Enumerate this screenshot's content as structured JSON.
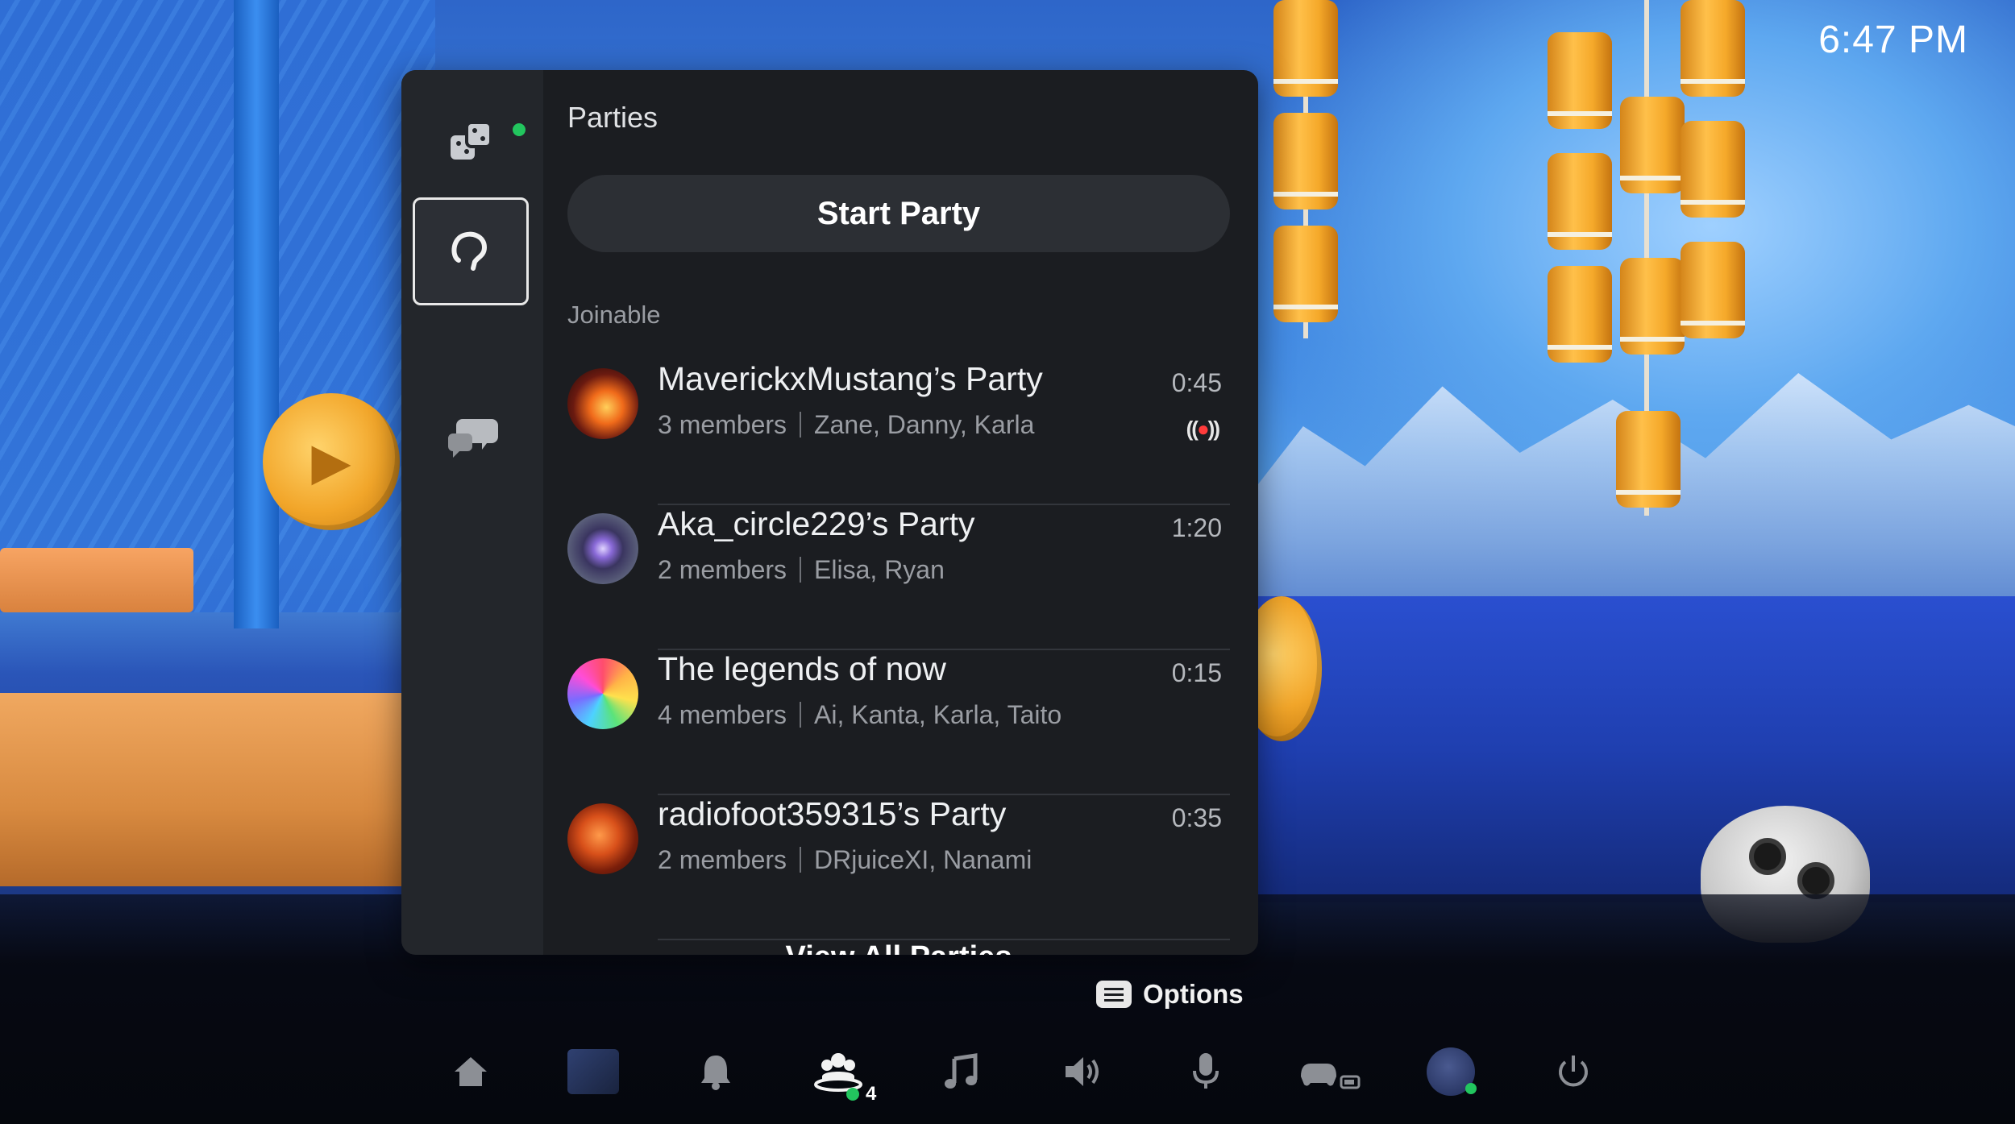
{
  "status_bar": {
    "time": "6:47 PM"
  },
  "parties_panel": {
    "title": "Parties",
    "start_party_label": "Start Party",
    "section_label": "Joinable",
    "parties": [
      {
        "name": "MaverickxMustang’s Party",
        "member_count": "3 members",
        "members": "Zane, Danny, Karla",
        "time": "0:45",
        "live": true,
        "avatar": "fire-avatar"
      },
      {
        "name": "Aka_circle229’s Party",
        "member_count": "2 members",
        "members": "Elisa, Ryan",
        "time": "1:20",
        "live": false,
        "avatar": "planet-avatar"
      },
      {
        "name": "The legends of now",
        "member_count": "4 members",
        "members": "Ai, Kanta, Karla, Taito",
        "time": "0:15",
        "live": false,
        "avatar": "rainbow-avatar"
      },
      {
        "name": "radiofoot359315’s Party",
        "member_count": "2 members",
        "members": "DRjuiceXI, Nanami",
        "time": "0:35",
        "live": false,
        "avatar": "lava-avatar"
      }
    ],
    "view_all_label": "View All Parties"
  },
  "options_hint": {
    "label": "Options"
  },
  "control_center": {
    "items": [
      "home-icon",
      "game-thumbnail",
      "notifications-icon",
      "game-base-icon",
      "music-icon",
      "sound-icon",
      "mic-icon",
      "controller-icon",
      "profile-avatar",
      "power-icon"
    ],
    "online_count": "4"
  },
  "colors": {
    "online": "#22c55e",
    "live": "#ff3b3b",
    "panel": "#1b1d21"
  }
}
